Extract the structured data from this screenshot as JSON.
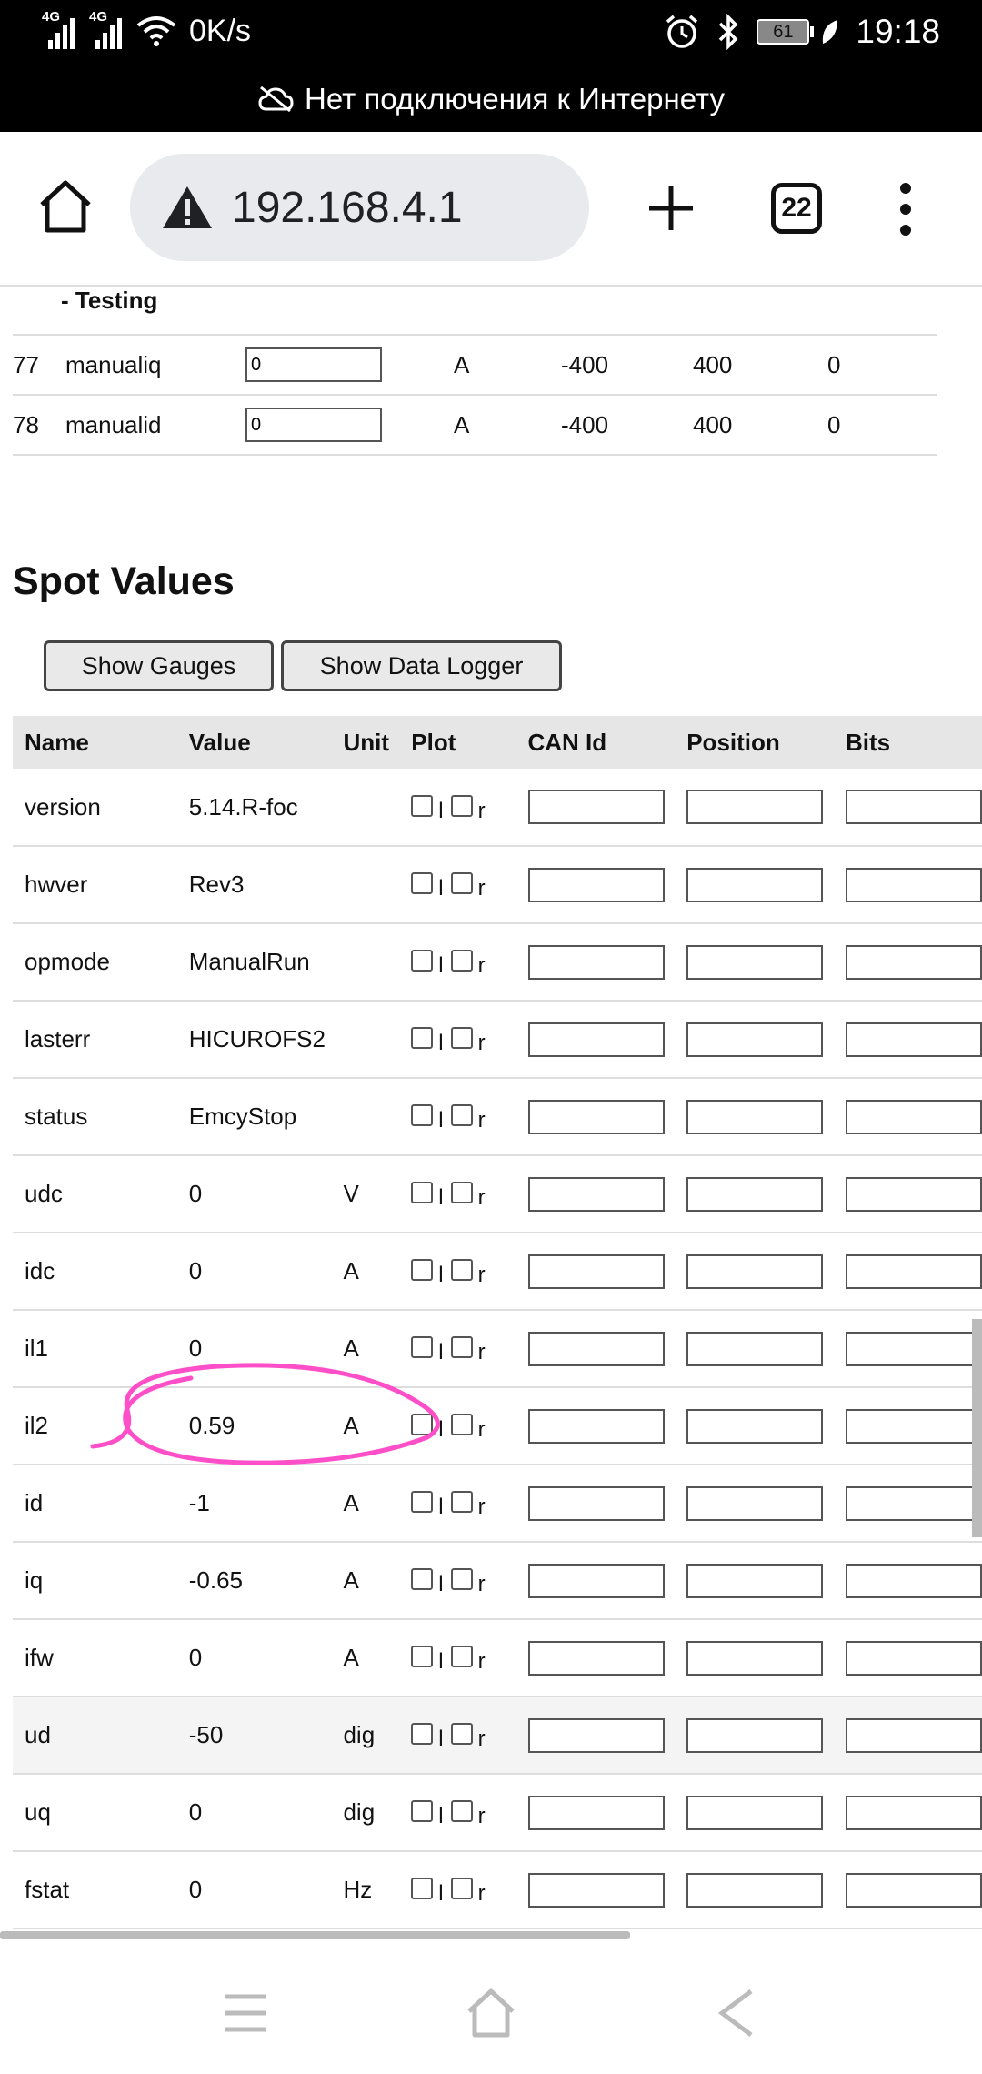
{
  "statusbar": {
    "signal1": "4G",
    "signal2": "4G",
    "speed": "0K/s",
    "battery": "61",
    "time": "19:18",
    "offline_text": "Нет подключения к Интернету"
  },
  "browser": {
    "url": "192.168.4.1",
    "tab_count": "22"
  },
  "params": {
    "section_label": "- Testing",
    "rows": [
      {
        "num": "77",
        "name": "manualiq",
        "value": "0",
        "unit": "A",
        "min": "-400",
        "max": "400",
        "default": "0"
      },
      {
        "num": "78",
        "name": "manualid",
        "value": "0",
        "unit": "A",
        "min": "-400",
        "max": "400",
        "default": "0"
      }
    ]
  },
  "spot": {
    "title": "Spot Values",
    "btn_gauges": "Show Gauges",
    "btn_logger": "Show Data Logger",
    "headers": {
      "name": "Name",
      "value": "Value",
      "unit": "Unit",
      "plot": "Plot",
      "canid": "CAN Id",
      "position": "Position",
      "bits": "Bits"
    },
    "plot_left": "l",
    "plot_right": "r",
    "rows": [
      {
        "name": "version",
        "value": "5.14.R-foc",
        "unit": ""
      },
      {
        "name": "hwver",
        "value": "Rev3",
        "unit": ""
      },
      {
        "name": "opmode",
        "value": "ManualRun",
        "unit": ""
      },
      {
        "name": "lasterr",
        "value": "HICUROFS2",
        "unit": ""
      },
      {
        "name": "status",
        "value": "EmcyStop",
        "unit": ""
      },
      {
        "name": "udc",
        "value": "0",
        "unit": "V"
      },
      {
        "name": "idc",
        "value": "0",
        "unit": "A"
      },
      {
        "name": "il1",
        "value": "0",
        "unit": "A"
      },
      {
        "name": "il2",
        "value": "0.59",
        "unit": "A"
      },
      {
        "name": "id",
        "value": "-1",
        "unit": "A"
      },
      {
        "name": "iq",
        "value": "-0.65",
        "unit": "A"
      },
      {
        "name": "ifw",
        "value": "0",
        "unit": "A"
      },
      {
        "name": "ud",
        "value": "-50",
        "unit": "dig"
      },
      {
        "name": "uq",
        "value": "0",
        "unit": "dig"
      },
      {
        "name": "fstat",
        "value": "0",
        "unit": "Hz"
      }
    ]
  },
  "colors": {
    "annotation": "#ff4fc8",
    "header_bg": "#e6e6e6",
    "pill_bg": "#e8eaed"
  }
}
